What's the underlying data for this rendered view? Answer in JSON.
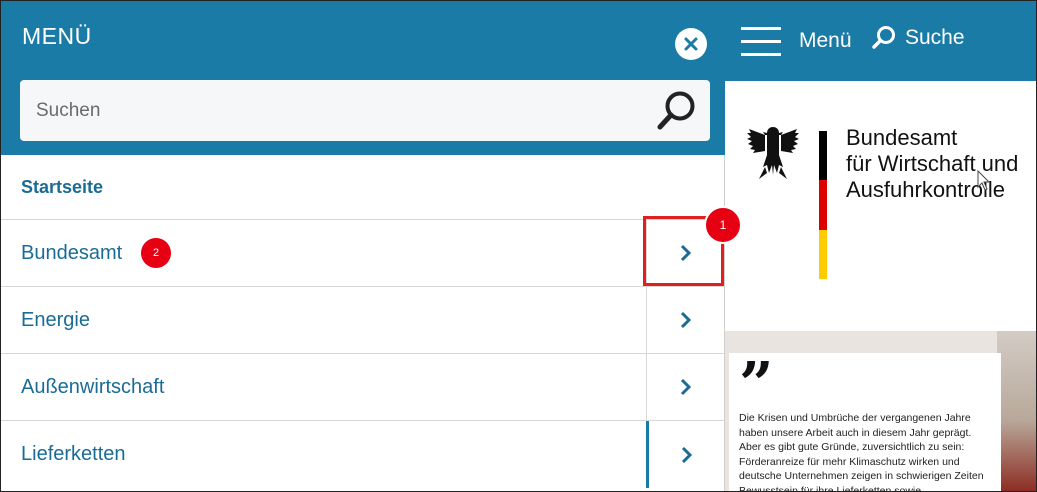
{
  "menu": {
    "title": "MENÜ",
    "search_placeholder": "Suchen",
    "items": [
      {
        "label": "Startseite"
      },
      {
        "label": "Bundesamt",
        "badge": "2"
      },
      {
        "label": "Energie"
      },
      {
        "label": "Außenwirtschaft"
      },
      {
        "label": "Lieferketten"
      }
    ]
  },
  "annotations": {
    "badge_1": "1"
  },
  "site": {
    "menu_label": "Menü",
    "search_label": "Suche",
    "org_name": [
      "Bundesamt",
      "für Wirtschaft und",
      "Ausfuhrkontrolle"
    ],
    "quote_mark": "”",
    "quote_text": "Die Krisen und Umbrüche der vergangenen Jahre haben unsere Arbeit auch in diesem Jahr geprägt. Aber es gibt gute Gründe, zuversichtlich zu sein: Förderanreize für mehr Klimaschutz wirken und deutsche Unternehmen zeigen in schwierigen Zeiten Bewusstsein für ihre Lieferketten sowie"
  },
  "colors": {
    "brand_blue": "#1a7ba6",
    "link_blue": "#1a6c95",
    "annotation_red": "#e60012",
    "flag": [
      "#000000",
      "#dd0000",
      "#ffcc00"
    ]
  },
  "icons": {
    "close": "close-icon",
    "search": "search-icon",
    "chevron": "chevron-right-icon",
    "hamburger": "hamburger-icon",
    "eagle": "federal-eagle-icon"
  }
}
